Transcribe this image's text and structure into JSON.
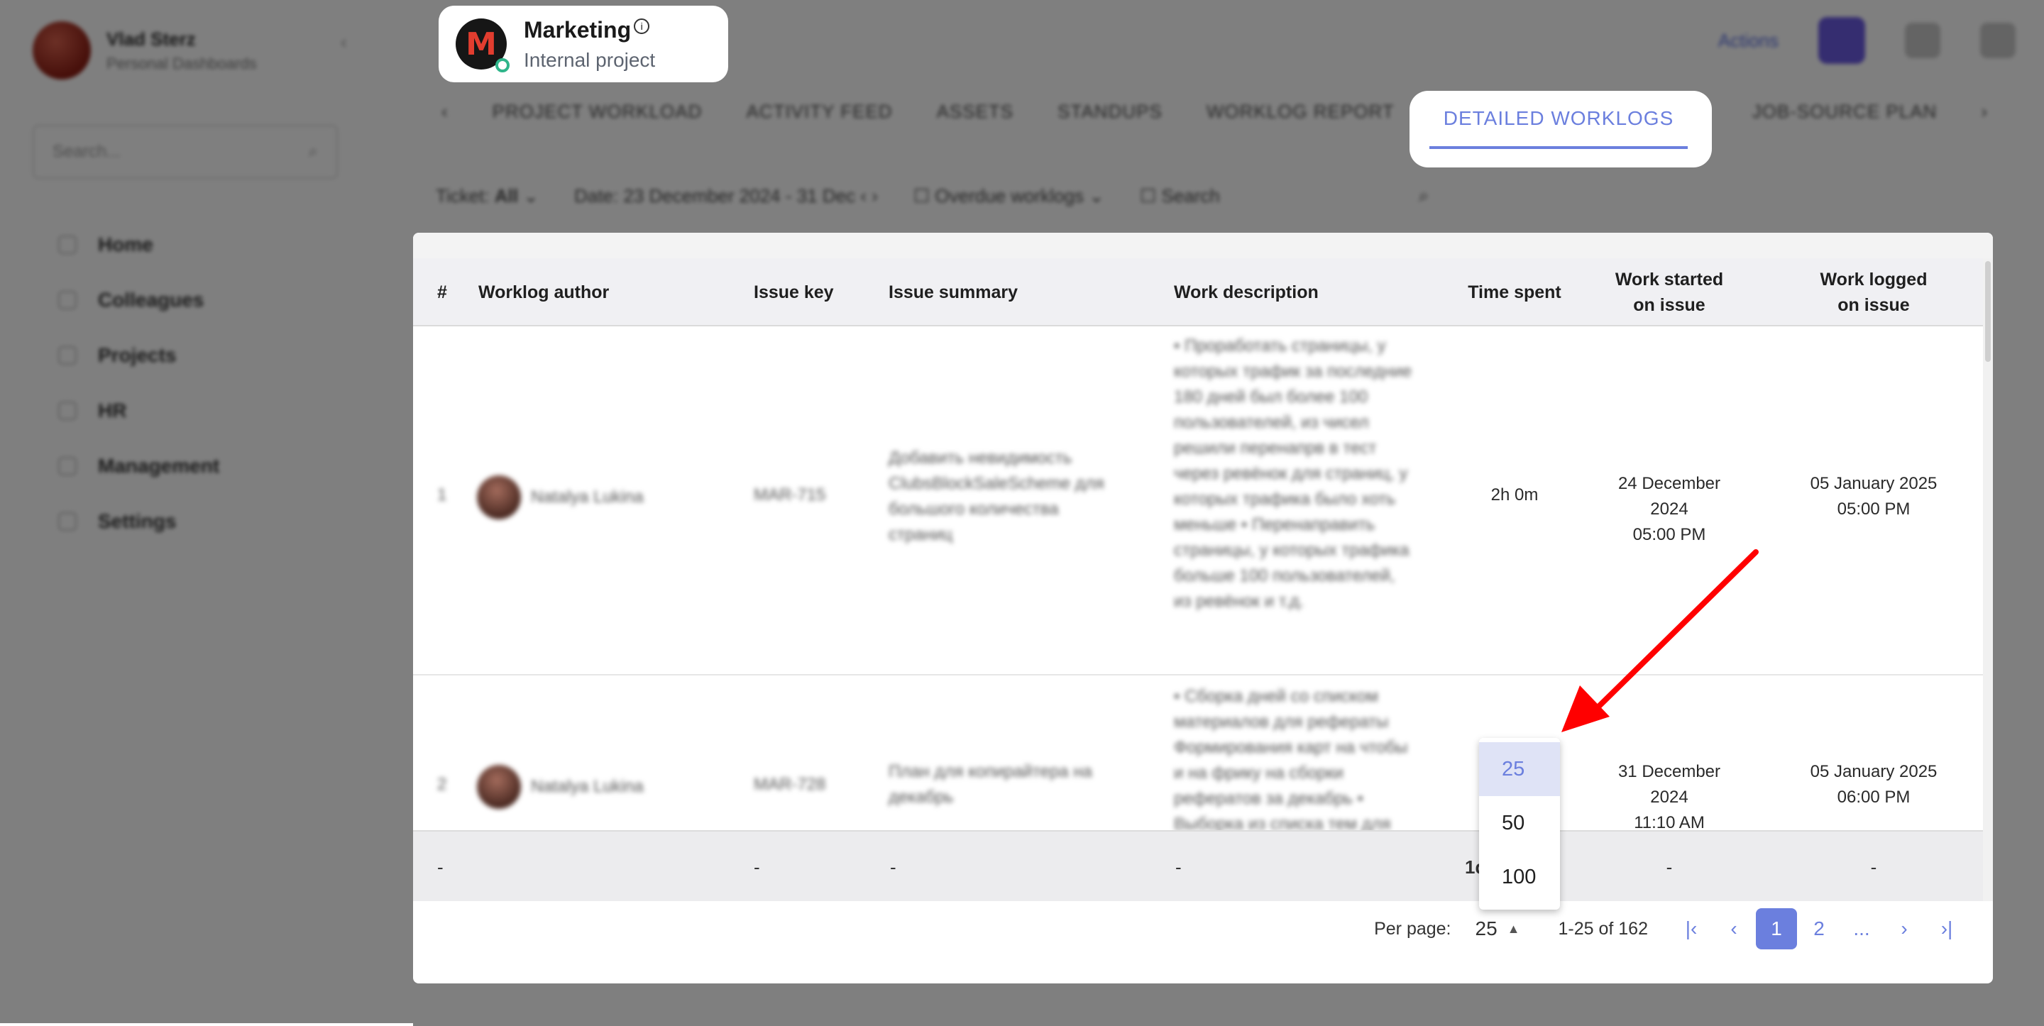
{
  "user": {
    "name": "Vlad Sterz",
    "role": "Personal Dashboards"
  },
  "sidebar": {
    "search_placeholder": "Search...",
    "items": [
      "Home",
      "Colleagues",
      "Projects",
      "HR",
      "Management",
      "Settings"
    ]
  },
  "project": {
    "name": "Marketing",
    "subtitle": "Internal project"
  },
  "tabs": [
    "PROJECT WORKLOAD",
    "ACTIVITY FEED",
    "ASSETS",
    "STANDUPS",
    "WORKLOG REPORT",
    "DETAILED WORKLOGS",
    "JOB-SOURCE PLAN"
  ],
  "active_tab": "DETAILED WORKLOGS",
  "filters": {
    "ticket_label": "Ticket",
    "ticket_value": "All",
    "date_label": "Date",
    "date_value": "23 December 2024 - 31 Dec",
    "worklog_filter": "Overdue worklogs",
    "search_placeholder": "Search"
  },
  "topbar": {
    "link": "Actions"
  },
  "table": {
    "columns": [
      "#",
      "Worklog author",
      "Issue key",
      "Issue summary",
      "Work description",
      "Time spent",
      "Work started on issue",
      "Work logged on issue"
    ],
    "rows": [
      {
        "num": "1",
        "author": "Natalya Lukina",
        "key": "MAR-715",
        "summary": "Добавить невидимость ClubsBlockSaleScheme для большого количества страниц",
        "description": "• Проработать страницы, у которых трафик за последние 180 дней был более 100 пользователей, из чисел решили перенапрв в тест через ревёнок для страниц, у которых трафика было хоть меньше • Перенаправить страницы, у которых трафика больше 100 пользователей, из ревёнок и т.д.",
        "time": "2h 0m",
        "started": "24 December 2024\n05:00 PM",
        "logged": "05 January 2025\n05:00 PM"
      },
      {
        "num": "2",
        "author": "Natalya Lukina",
        "key": "MAR-728",
        "summary": "План для копирайтера на декабрь",
        "description": "• Сборка дней со списком материалов для рефераты Формирования карт на чтобы и на фрику на сборки рефератов за декабрь • Выборка из списка тем для",
        "time": "",
        "started": "31 December 2024\n11:10 AM",
        "logged": "05 January 2025\n06:00 PM"
      }
    ],
    "totals": {
      "num": "-",
      "key": "-",
      "summary": "-",
      "description": "-",
      "time": "1d",
      "started": "-",
      "logged": "-"
    }
  },
  "pagination": {
    "per_page_label": "Per page:",
    "per_page_value": "25",
    "range": "1-25 of 162",
    "pages": [
      "1",
      "2",
      "..."
    ],
    "current_page": "1"
  },
  "per_page_dropdown": {
    "options": [
      "25",
      "50",
      "100"
    ],
    "selected": "25"
  },
  "annotation": {
    "arrow_color": "#ff0000"
  },
  "colors": {
    "accent": "#6b7fde",
    "overlay": "rgba(0,0,0,0.5)"
  }
}
